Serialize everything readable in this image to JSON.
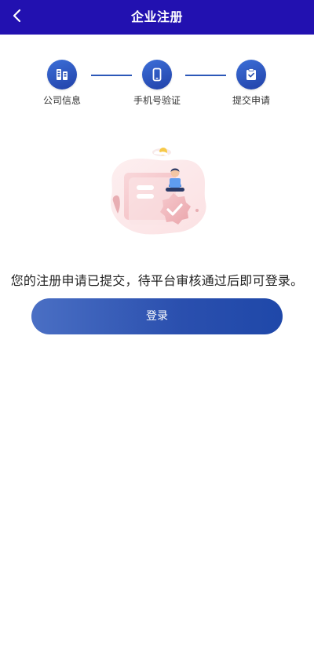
{
  "header": {
    "title": "企业注册",
    "back_icon": "chevron-left-icon",
    "background_color": "#2211b0"
  },
  "steps": [
    {
      "label": "公司信息",
      "icon": "building-icon"
    },
    {
      "label": "手机号验证",
      "icon": "phone-icon"
    },
    {
      "label": "提交申请",
      "icon": "clipboard-check-icon"
    }
  ],
  "illustration": {
    "icon": "submitted-success-illustration"
  },
  "message": {
    "text": "您的注册申请已提交，待平台审核通过后即可登录。"
  },
  "actions": {
    "login_label": "登录"
  },
  "colors": {
    "accent": "#2c58b8",
    "button_start": "#4a6fc4",
    "button_end": "#1f48a9"
  }
}
